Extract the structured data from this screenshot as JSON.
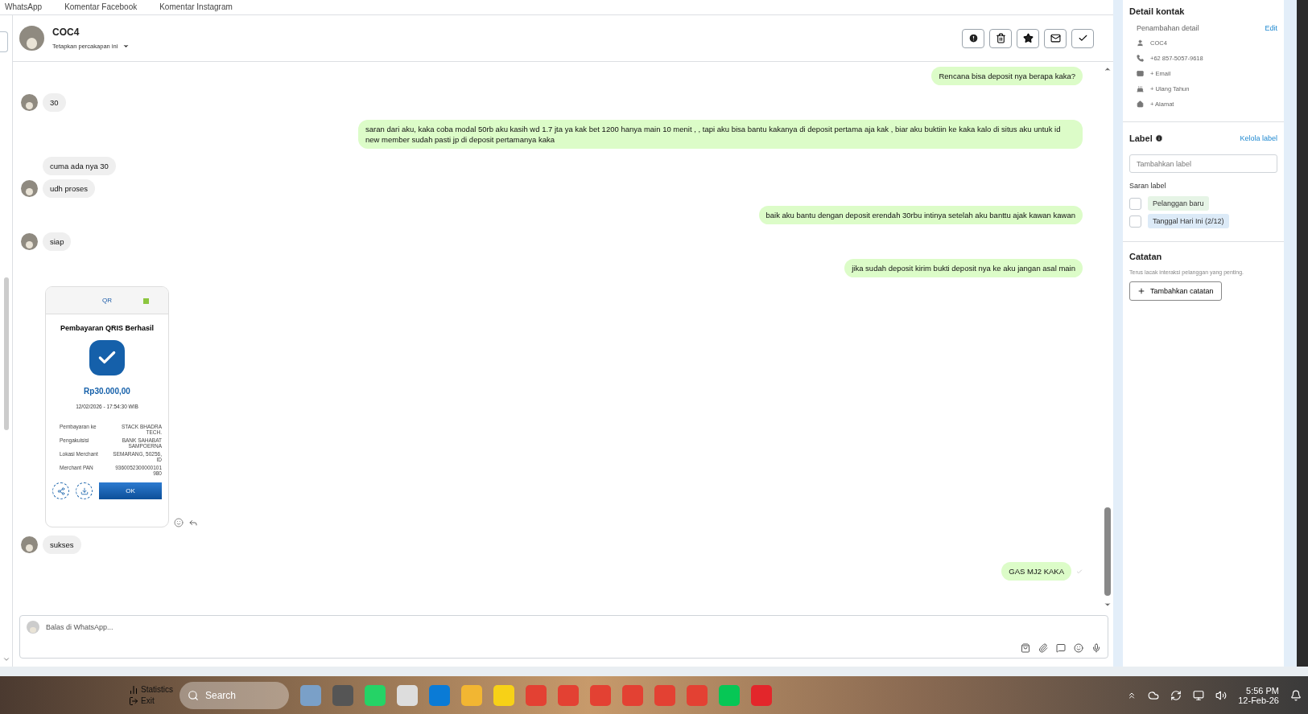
{
  "top_tabs": [
    {
      "label": "WhatsApp"
    },
    {
      "label": "Komentar Facebook"
    },
    {
      "label": "Komentar Instagram"
    }
  ],
  "chat": {
    "contact_name": "COC4",
    "pin_label": "Tetapkan percakapan ini",
    "messages": [
      {
        "kind": "outgoing",
        "text": "Rencana bisa deposit nya berapa kaka?"
      },
      {
        "kind": "incoming",
        "text": "30"
      },
      {
        "kind": "outgoing",
        "text": "saran dari aku, kaka coba modal 50rb aku kasih wd 1.7 jta ya kak bet 1200 hanya main 10 menit , , tapi aku bisa bantu kakanya di deposit pertama aja kak , biar aku buktiin ke kaka kalo di situs aku untuk id new member sudah pasti jp di deposit pertamanya kaka"
      },
      {
        "kind": "incoming",
        "text": "cuma ada nya 30",
        "avatar": false
      },
      {
        "kind": "incoming",
        "text": "udh proses"
      },
      {
        "kind": "outgoing",
        "text": "baik aku bantu dengan deposit erendah 30rbu intinya setelah aku banttu ajak kawan kawan"
      },
      {
        "kind": "incoming",
        "text": "siap"
      },
      {
        "kind": "outgoing",
        "text": "jika sudah deposit kirim bukti deposit nya ke aku jangan asal main"
      },
      {
        "kind": "receipt",
        "tab": "QR",
        "title": "Pembayaran QRIS Berhasil",
        "amount": "Rp30.000,00",
        "datetime": "12/02/2026 - 17:54:30 WIB",
        "rows": [
          {
            "label": "Pembayaran ke",
            "value": "STACK BHADRA TECH."
          },
          {
            "label": "Pengakuisisi",
            "value": "BANK SAHABAT SAMPOERNA"
          },
          {
            "label": "Lokasi Merchant",
            "value": "SEMARANG, 50256, ID"
          },
          {
            "label": "Merchant PAN",
            "value": "9360052300000101 980"
          }
        ],
        "button": "OK"
      },
      {
        "kind": "incoming",
        "text": "sukses"
      },
      {
        "kind": "outgoing",
        "text": "GAS MJ2 KAKA",
        "seen": true
      }
    ],
    "composer": {
      "placeholder": "Balas di WhatsApp..."
    }
  },
  "contact": {
    "title": "Detail kontak",
    "subtitle": "Penambahan detail",
    "edit": "Edit",
    "fields": [
      {
        "kind": "name",
        "text": "COC4"
      },
      {
        "kind": "phone",
        "text": "+62 857-5057-9618"
      },
      {
        "kind": "email",
        "text": "+ Email"
      },
      {
        "kind": "birthday",
        "text": "+ Ulang Tahun"
      },
      {
        "kind": "address",
        "text": "+ Alamat"
      }
    ]
  },
  "labels": {
    "title": "Label",
    "manage": "Kelola label",
    "input_placeholder": "Tambahkan label",
    "suggest_title": "Saran label",
    "suggestions": [
      {
        "text": "Pelanggan baru",
        "checked": false,
        "color": "#e6f4e6"
      },
      {
        "text": "Tanggal Hari Ini (2/12)",
        "checked": false,
        "color": "#dceaf7"
      }
    ]
  },
  "notes": {
    "title": "Catatan",
    "hint": "Terus lacak interaksi pelanggan yang penting.",
    "button": "Tambahkan catatan"
  },
  "taskbar": {
    "search": "Search",
    "overlay_labels": [
      "Statistics",
      "Exit"
    ],
    "time": "5:56 PM",
    "date": "12-Feb-26"
  }
}
